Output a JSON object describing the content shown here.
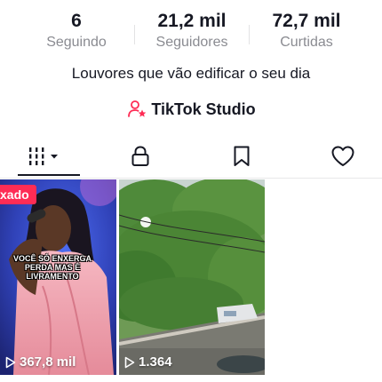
{
  "profile": {
    "stats": [
      {
        "value": "6",
        "label": "Seguindo"
      },
      {
        "value": "21,2 mil",
        "label": "Seguidores"
      },
      {
        "value": "72,7 mil",
        "label": "Curtidas"
      }
    ],
    "bio": "Louvores que vão edificar o seu dia",
    "studio_link": "TikTok Studio"
  },
  "tabs": [
    {
      "icon": "grid-icon",
      "active": true
    },
    {
      "icon": "lock-icon"
    },
    {
      "icon": "bookmark-icon"
    },
    {
      "icon": "heart-icon"
    }
  ],
  "videos": [
    {
      "badge": "xado",
      "caption": "VOCÊ SÓ ENXERGA PERDA MAS É LIVRAMENTO",
      "views": "367,8 mil"
    },
    {
      "views": "1.364"
    }
  ],
  "colors": {
    "accent": "#fe2c55",
    "text": "#161823",
    "muted": "#8a8b91"
  }
}
